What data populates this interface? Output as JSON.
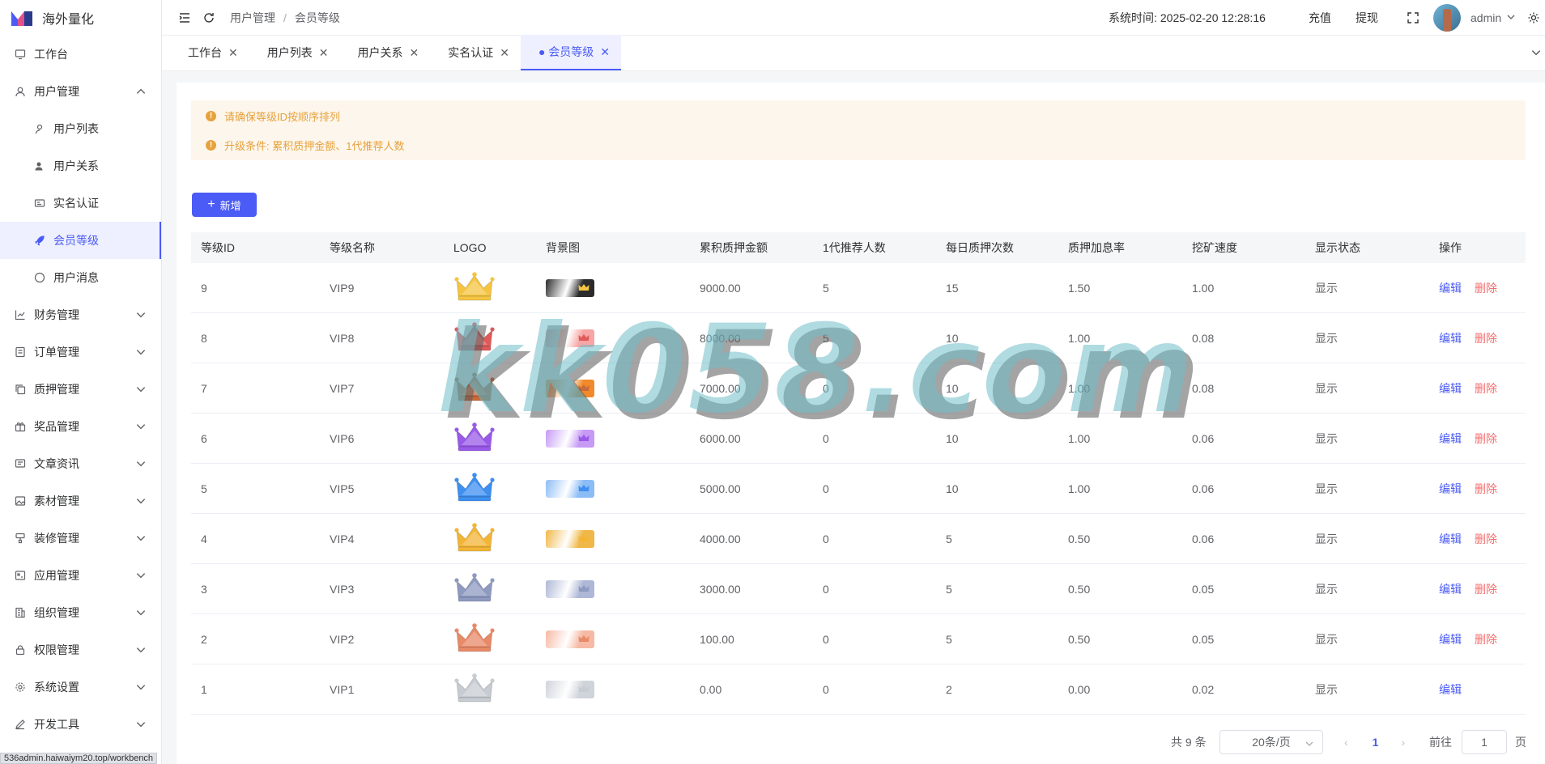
{
  "app": {
    "name": "海外量化"
  },
  "sidebar": {
    "items": [
      {
        "label": "工作台",
        "icon": "monitor-icon"
      },
      {
        "label": "用户管理",
        "icon": "user-icon",
        "expanded": true,
        "children": [
          {
            "label": "用户列表",
            "icon": "user-outline-icon"
          },
          {
            "label": "用户关系",
            "icon": "users-icon"
          },
          {
            "label": "实名认证",
            "icon": "id-card-icon"
          },
          {
            "label": "会员等级",
            "icon": "rocket-icon",
            "active": true
          },
          {
            "label": "用户消息",
            "icon": "chat-icon"
          }
        ]
      },
      {
        "label": "财务管理",
        "icon": "chart-icon"
      },
      {
        "label": "订单管理",
        "icon": "order-icon"
      },
      {
        "label": "质押管理",
        "icon": "copy-icon"
      },
      {
        "label": "奖品管理",
        "icon": "gift-icon"
      },
      {
        "label": "文章资讯",
        "icon": "message-icon"
      },
      {
        "label": "素材管理",
        "icon": "image-icon"
      },
      {
        "label": "装修管理",
        "icon": "brush-icon"
      },
      {
        "label": "应用管理",
        "icon": "app-icon"
      },
      {
        "label": "组织管理",
        "icon": "building-icon"
      },
      {
        "label": "权限管理",
        "icon": "lock-icon"
      },
      {
        "label": "系统设置",
        "icon": "gear-icon"
      },
      {
        "label": "开发工具",
        "icon": "pen-icon"
      }
    ]
  },
  "header": {
    "breadcrumb": [
      "用户管理",
      "会员等级"
    ],
    "system_time_label": "系统时间:",
    "system_time": "2025-02-20 12:28:16",
    "recharge": "充值",
    "withdraw": "提现",
    "username": "admin"
  },
  "tabs": [
    {
      "label": "工作台"
    },
    {
      "label": "用户列表"
    },
    {
      "label": "用户关系"
    },
    {
      "label": "实名认证"
    },
    {
      "label": "● 会员等级",
      "active": true
    }
  ],
  "alerts": [
    "请确保等级ID按顺序排列",
    "升级条件: 累积质押金额、1代推荐人数"
  ],
  "add_button": "新增",
  "table": {
    "headers": [
      "等级ID",
      "等级名称",
      "LOGO",
      "背景图",
      "累积质押金额",
      "1代推荐人数",
      "每日质押次数",
      "质押加息率",
      "挖矿速度",
      "显示状态",
      "操作"
    ],
    "rows": [
      {
        "id": "9",
        "name": "VIP9",
        "amount": "9000.00",
        "refs": "5",
        "daily": "15",
        "rate": "1.50",
        "speed": "1.00",
        "status": "显示",
        "crown": "#f5c542",
        "bg": "#2b2b2b",
        "deletable": true
      },
      {
        "id": "8",
        "name": "VIP8",
        "amount": "8000.00",
        "refs": "5",
        "daily": "10",
        "rate": "1.00",
        "speed": "0.08",
        "status": "显示",
        "crown": "#e05a5a",
        "bg": "#f7a5a5",
        "deletable": true
      },
      {
        "id": "7",
        "name": "VIP7",
        "amount": "7000.00",
        "refs": "0",
        "daily": "10",
        "rate": "1.00",
        "speed": "0.08",
        "status": "显示",
        "crown": "#c96a3a",
        "bg": "#f08a2a",
        "deletable": true
      },
      {
        "id": "6",
        "name": "VIP6",
        "amount": "6000.00",
        "refs": "0",
        "daily": "10",
        "rate": "1.00",
        "speed": "0.06",
        "status": "显示",
        "crown": "#9a5ae8",
        "bg": "#c69af5",
        "deletable": true
      },
      {
        "id": "5",
        "name": "VIP5",
        "amount": "5000.00",
        "refs": "0",
        "daily": "10",
        "rate": "1.00",
        "speed": "0.06",
        "status": "显示",
        "crown": "#3e8ff0",
        "bg": "#8cbcf5",
        "deletable": true
      },
      {
        "id": "4",
        "name": "VIP4",
        "amount": "4000.00",
        "refs": "0",
        "daily": "5",
        "rate": "0.50",
        "speed": "0.06",
        "status": "显示",
        "crown": "#f3b536",
        "bg": "#f0b848",
        "deletable": true
      },
      {
        "id": "3",
        "name": "VIP3",
        "amount": "3000.00",
        "refs": "0",
        "daily": "5",
        "rate": "0.50",
        "speed": "0.05",
        "status": "显示",
        "crown": "#8e9ac0",
        "bg": "#aeb8d6",
        "deletable": true
      },
      {
        "id": "2",
        "name": "VIP2",
        "amount": "100.00",
        "refs": "0",
        "daily": "5",
        "rate": "0.50",
        "speed": "0.05",
        "status": "显示",
        "crown": "#e88a68",
        "bg": "#f6b9a4",
        "deletable": true
      },
      {
        "id": "1",
        "name": "VIP1",
        "amount": "0.00",
        "refs": "0",
        "daily": "2",
        "rate": "0.00",
        "speed": "0.02",
        "status": "显示",
        "crown": "#c7ccd2",
        "bg": "#cfd4da",
        "deletable": false
      }
    ],
    "edit_label": "编辑",
    "delete_label": "删除"
  },
  "pagination": {
    "total": "共 9 条",
    "page_size": "20条/页",
    "current_page": "1",
    "goto_label": "前往",
    "goto_value": "1",
    "page_suffix": "页"
  },
  "statusbar": "536admin.haiwaiym20.top/workbench",
  "watermark": "kk058.com",
  "colors": {
    "accent": "#4b5bf5",
    "danger": "#f56c6c",
    "warning": "#e6a23c"
  }
}
